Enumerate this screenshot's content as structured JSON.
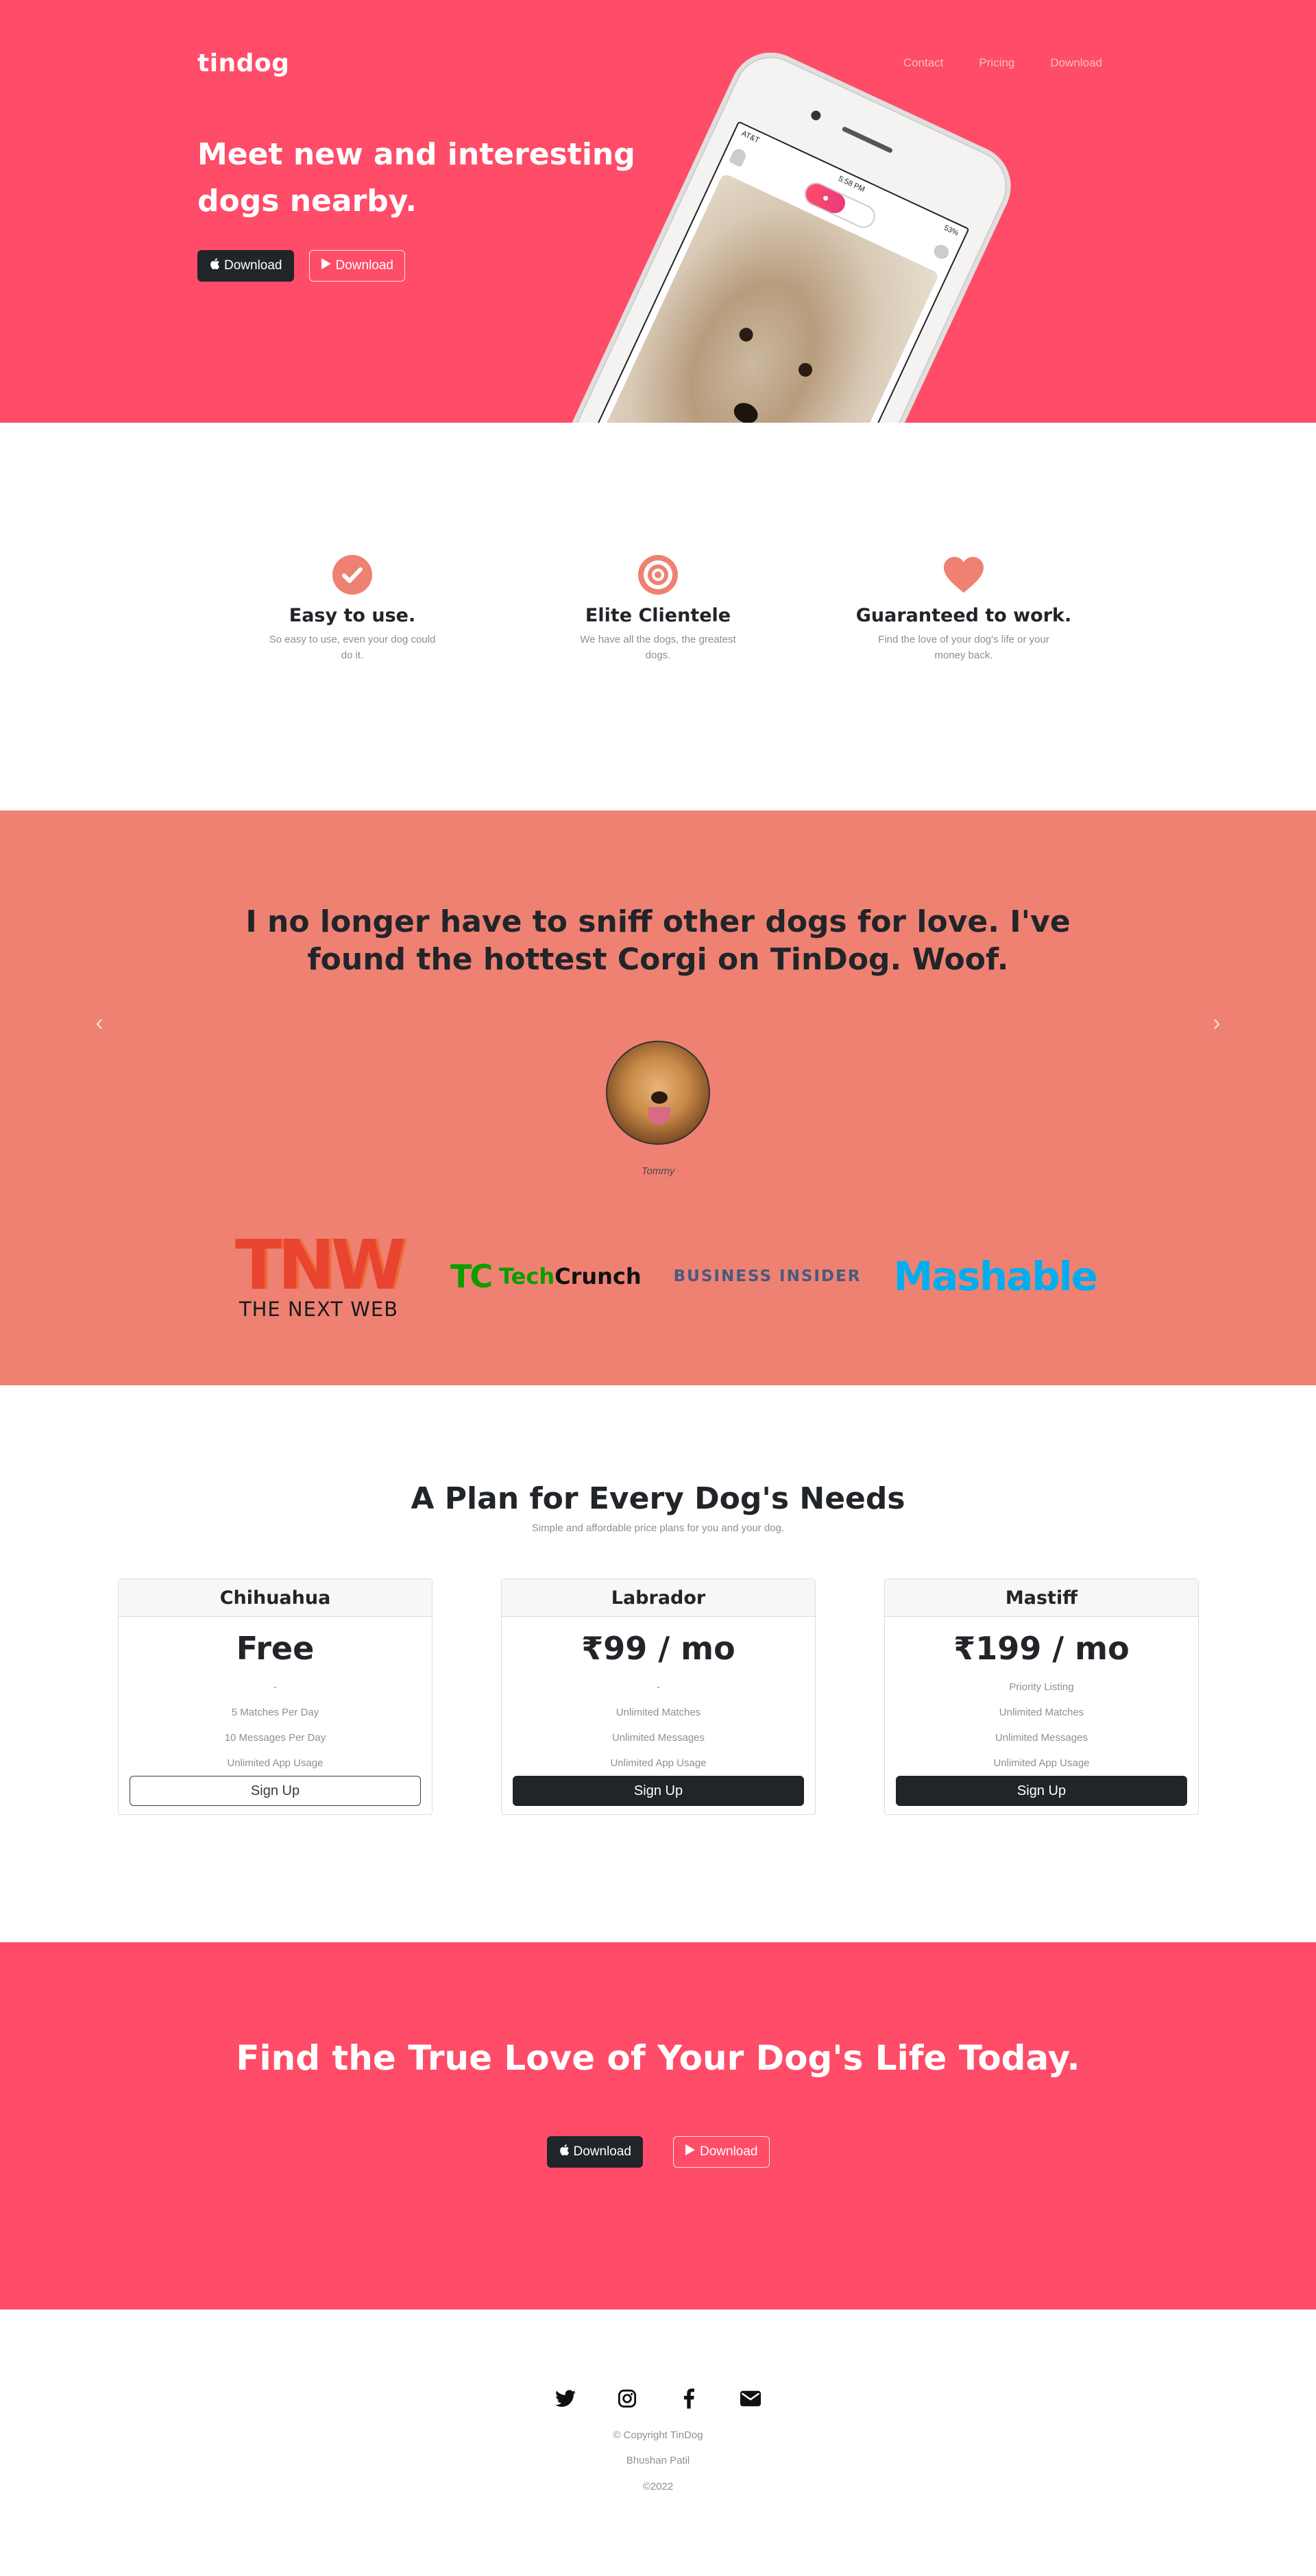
{
  "nav": {
    "brand": "tindog",
    "links": [
      "Contact",
      "Pricing",
      "Download"
    ]
  },
  "hero": {
    "title": "Meet new and interesting dogs nearby.",
    "download_apple": "Download",
    "download_play": "Download",
    "phone_status": {
      "carrier": "AT&T",
      "time": "5:58 PM",
      "battery": "53%"
    }
  },
  "features": [
    {
      "icon": "check-circle-icon",
      "title": "Easy to use.",
      "text": "So easy to use, even your dog could do it."
    },
    {
      "icon": "bullseye-icon",
      "title": "Elite Clientele",
      "text": "We have all the dogs, the greatest dogs."
    },
    {
      "icon": "heart-icon",
      "title": "Guaranteed to work.",
      "text": "Find the love of your dog's life or your money back."
    }
  ],
  "testimonial": {
    "quote": "I no longer have to sniff other dogs for love. I've found the hottest Corgi on TinDog. Woof.",
    "name": "Tommy"
  },
  "press": {
    "tnw_mark": "TNW",
    "tnw_name": "THE NEXT WEB",
    "techcrunch_mark": "TC",
    "techcrunch_tech": "Tech",
    "techcrunch_crunch": "Crunch",
    "business_insider": "BUSINESS INSIDER",
    "mashable": "Mashable"
  },
  "pricing": {
    "title": "A Plan for Every Dog's Needs",
    "subtitle": "Simple and affordable price plans for you and your dog.",
    "plans": [
      {
        "name": "Chihuahua",
        "price": "Free",
        "features": [
          "-",
          "5 Matches Per Day",
          "10 Messages Per Day",
          "Unlimited App Usage"
        ],
        "button": "Sign Up"
      },
      {
        "name": "Labrador",
        "price": "₹99 / mo",
        "features": [
          "-",
          "Unlimited Matches",
          "Unlimited Messages",
          "Unlimited App Usage"
        ],
        "button": "Sign Up"
      },
      {
        "name": "Mastiff",
        "price": "₹199 / mo",
        "features": [
          "Priority Listing",
          "Unlimited Matches",
          "Unlimited Messages",
          "Unlimited App Usage"
        ],
        "button": "Sign Up"
      }
    ]
  },
  "cta": {
    "title": "Find the True Love of Your Dog's Life Today.",
    "download_apple": "Download",
    "download_play": "Download"
  },
  "footer": {
    "socials": [
      "twitter-icon",
      "instagram-icon",
      "facebook-icon",
      "envelope-icon"
    ],
    "copyright": "© Copyright TinDog",
    "author": "Bhushan Patil",
    "year": "©2022"
  },
  "colors": {
    "brand_red": "#ff4c68",
    "testimonial_bg": "#ef8172",
    "dark": "#212529",
    "muted": "#8f8f8f"
  }
}
